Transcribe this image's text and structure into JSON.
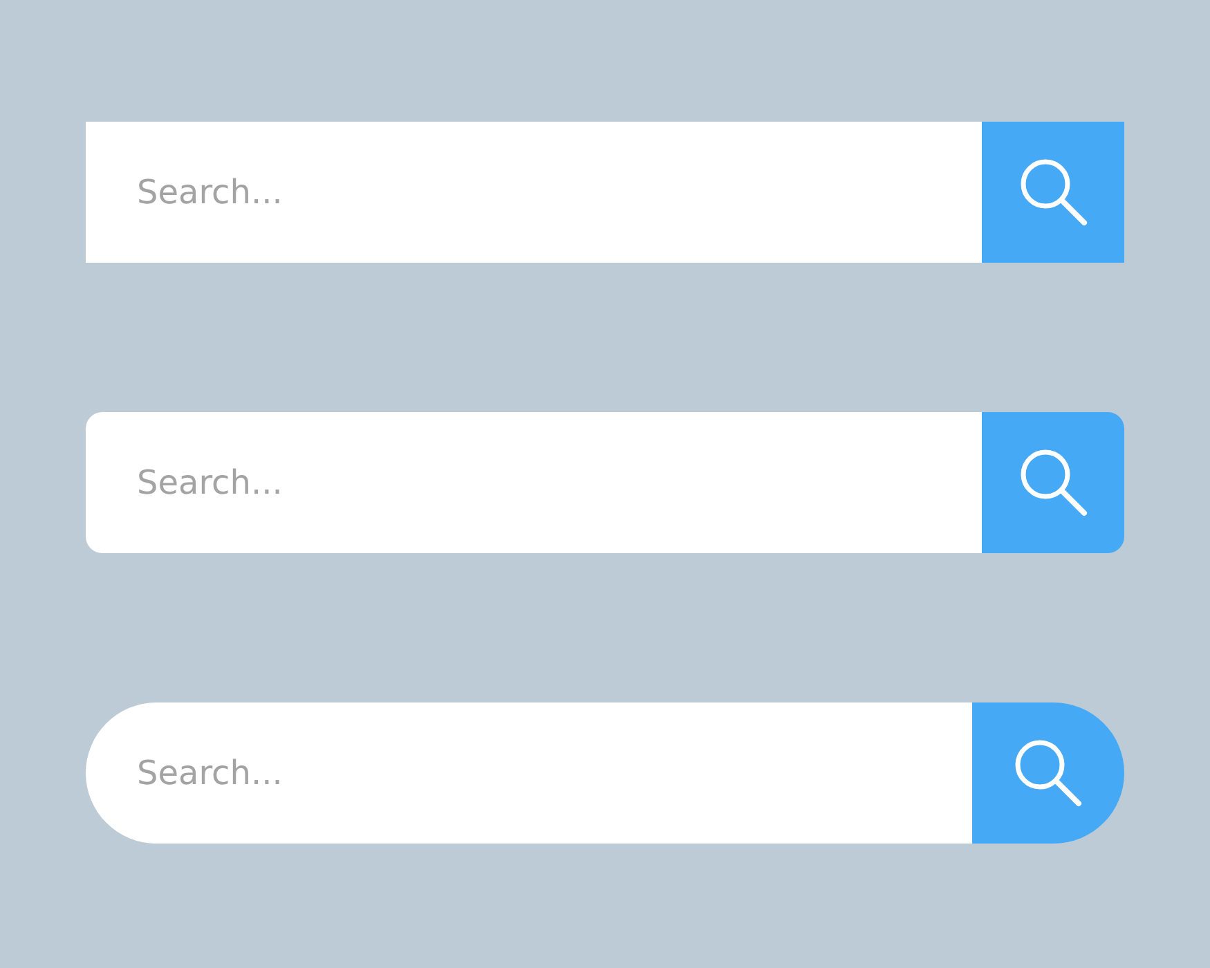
{
  "search_bars": [
    {
      "kind": "square",
      "placeholder": "Search..."
    },
    {
      "kind": "rounded",
      "placeholder": "Search..."
    },
    {
      "kind": "pill",
      "placeholder": "Search..."
    }
  ]
}
